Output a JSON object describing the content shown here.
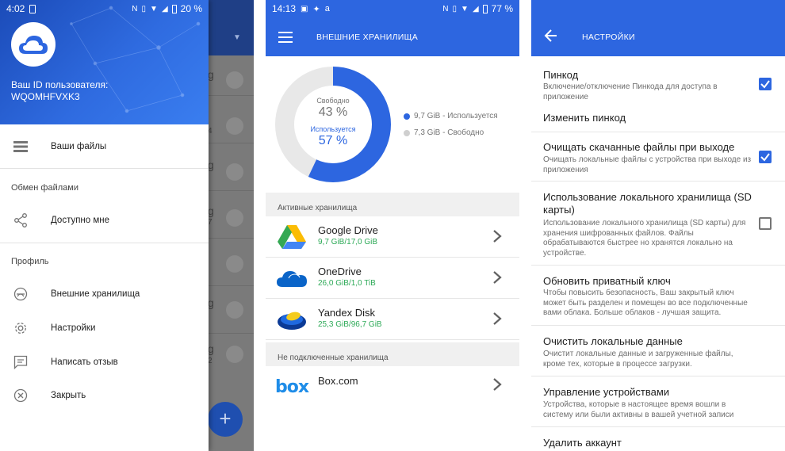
{
  "screen1": {
    "status": {
      "time": "4:02",
      "battery": "20 %"
    },
    "user_id_label": "Ваш ID пользователя:",
    "user_id": "WQOMHFVXK3",
    "bg_letters": [
      "g",
      "4",
      "g",
      "g",
      "7",
      "g",
      "g",
      "2"
    ],
    "fab": "+",
    "items": {
      "files": "Ваши файлы",
      "sharing_title": "Обмен файлами",
      "shared": "Доступно мне",
      "profile_title": "Профиль",
      "external": "Внешние хранилища",
      "settings": "Настройки",
      "feedback": "Написать отзыв",
      "close": "Закрыть"
    }
  },
  "screen2": {
    "status": {
      "time": "14:13",
      "battery": "77 %"
    },
    "title": "ВНЕШНИЕ ХРАНИЛИЩА",
    "donut": {
      "free_label": "Свободно",
      "free_pct": "43 %",
      "used_label": "Используется",
      "used_pct": "57 %",
      "used_fraction": 0.57,
      "used_color": "#2d66e0",
      "free_color": "#e8e8e8"
    },
    "legend": {
      "used": "9,7 GiB - Используется",
      "free": "7,3 GiB - Свободно"
    },
    "active_title": "Активные хранилища",
    "active": [
      {
        "name": "Google Drive",
        "size": "9,7 GiB/17,0 GiB"
      },
      {
        "name": "OneDrive",
        "size": "26,0 GiB/1,0 TiB"
      },
      {
        "name": "Yandex Disk",
        "size": "25,3 GiB/96,7 GiB"
      }
    ],
    "inactive_title": "Не подключенные хранилища",
    "inactive": [
      {
        "name": "Box.com",
        "logo_text": "box"
      }
    ]
  },
  "screen3": {
    "status": {
      "time": "",
      "battery": ""
    },
    "title": "НАСТРОЙКИ",
    "prefs": [
      {
        "title": "Пинкод",
        "desc": "Включение/отключение Пинкода для доступа в приложение",
        "checked": true
      },
      {
        "title": "Изменить пинкод",
        "desc": ""
      },
      {
        "title": "Очищать скачанные файлы при выходе",
        "desc": "Очищать локальные файлы с устройства при выходе из приложения",
        "checked": true
      },
      {
        "title": "Использование локального хранилища (SD карты)",
        "desc": "Использование локального хранилища (SD карты) для хранения шифрованных файлов. Файлы обрабатываются быстрее но хранятся локально на устройстве.",
        "checked": false
      },
      {
        "title": "Обновить приватный ключ",
        "desc": "Чтобы повысить безопасность, Ваш закрытый ключ может быть разделен и помещен во все подключенные вами облака. Больше облаков - лучшая защита."
      },
      {
        "title": "Очистить локальные данные",
        "desc": "Очистит локальные данные и загруженные файлы, кроме тех, которые в процессе загрузки."
      },
      {
        "title": "Управление устройствами",
        "desc": "Устройства, которые в настоящее время вошли в систему или были активны в вашей учетной записи"
      },
      {
        "title": "Удалить аккаунт",
        "desc": ""
      }
    ]
  }
}
